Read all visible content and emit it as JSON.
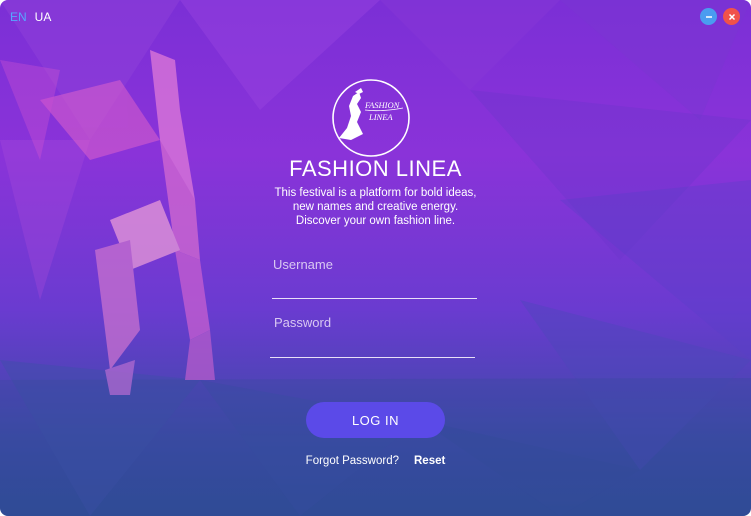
{
  "language": {
    "options": [
      "EN",
      "UA"
    ],
    "selected": "EN"
  },
  "window_controls": {
    "minimize_icon": "minus-icon",
    "close_icon": "close-icon",
    "minimize_color": "#4a9cf0",
    "close_color": "#f0524a"
  },
  "logo": {
    "line1": "FASHION",
    "line2": "LINEA"
  },
  "title": "FASHION LINEA",
  "subtitle": {
    "line1": "This festival is a platform for bold ideas,",
    "line2": "new names and creative energy.",
    "line3": "Discover your own fashion line."
  },
  "form": {
    "username_label": "Username",
    "username_value": "",
    "password_label": "Password",
    "password_value": ""
  },
  "login_button": "LOG IN",
  "forgot": {
    "text": "Forgot Password?",
    "reset_label": "Reset"
  },
  "colors": {
    "accent": "#5b4ae8",
    "language_active": "#56a7ff"
  }
}
